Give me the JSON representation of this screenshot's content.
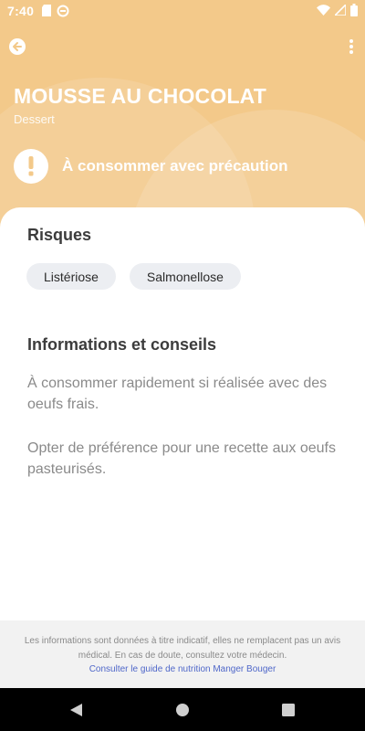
{
  "status_bar": {
    "time": "7:40"
  },
  "header": {
    "title": "MOUSSE AU CHOCOLAT",
    "subtitle": "Dessert",
    "warning": "À consommer avec précaution"
  },
  "risks": {
    "heading": "Risques",
    "chips": [
      "Listériose",
      "Salmonellose"
    ]
  },
  "info": {
    "heading": "Informations et conseils",
    "paragraphs": [
      "À consommer rapidement si réalisée avec des oeufs frais.",
      "Opter de préférence pour une recette aux oeufs pasteurisés."
    ]
  },
  "footer": {
    "disclaimer": "Les informations sont données à titre indicatif, elles ne remplacent pas un avis médical. En cas de doute, consultez votre médecin.",
    "link": "Consulter le guide de nutrition Manger Bouger"
  },
  "colors": {
    "header_bg": "#f3c98a",
    "link": "#4f67c9",
    "chip_bg": "#eceef2"
  },
  "icons": {
    "back": "arrow-left-circle-icon",
    "menu": "more-vert-icon",
    "warning": "exclamation-icon"
  }
}
